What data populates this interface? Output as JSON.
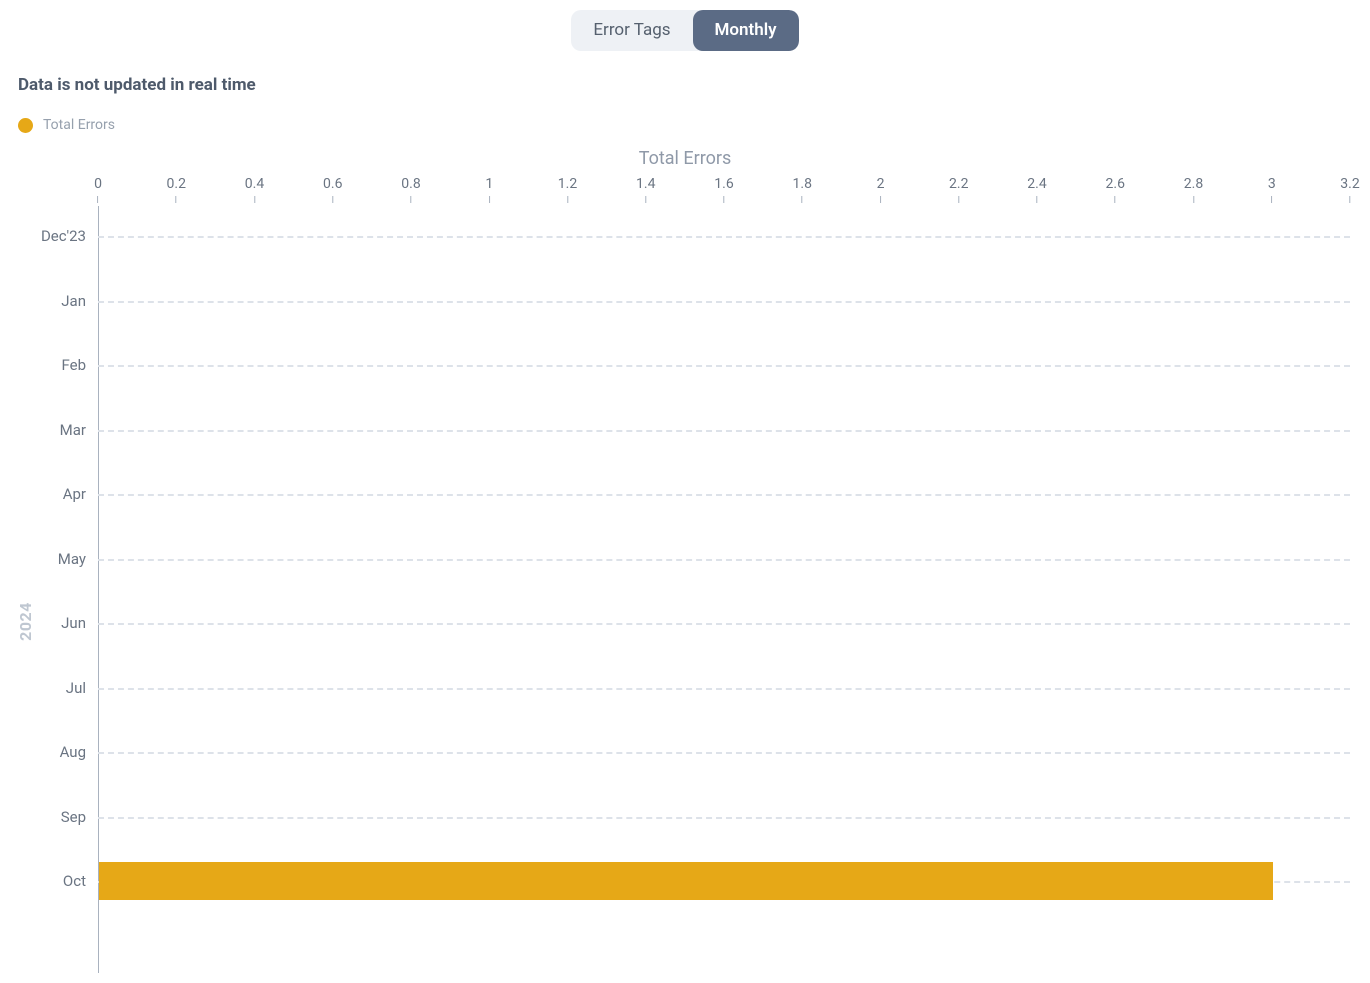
{
  "tabs": {
    "error_tags": "Error Tags",
    "monthly": "Monthly",
    "active": "monthly"
  },
  "note": "Data is not updated in real time",
  "legend": {
    "label": "Total Errors",
    "color": "#e6a817"
  },
  "year_label": "2024",
  "chart_data": {
    "type": "bar",
    "orientation": "horizontal",
    "title": "Total Errors",
    "xlabel": "Total Errors",
    "ylabel": "2024",
    "xlim": [
      0,
      3.2
    ],
    "xticks": [
      0,
      0.2,
      0.4,
      0.6,
      0.8,
      1,
      1.2,
      1.4,
      1.6,
      1.8,
      2,
      2.2,
      2.4,
      2.6,
      2.8,
      3,
      3.2
    ],
    "categories": [
      "Dec'23",
      "Jan",
      "Feb",
      "Mar",
      "Apr",
      "May",
      "Jun",
      "Jul",
      "Aug",
      "Sep",
      "Oct"
    ],
    "series": [
      {
        "name": "Total Errors",
        "color": "#e6a817",
        "values": [
          0,
          0,
          0,
          0,
          0,
          0,
          0,
          0,
          0,
          0,
          3
        ]
      }
    ]
  }
}
